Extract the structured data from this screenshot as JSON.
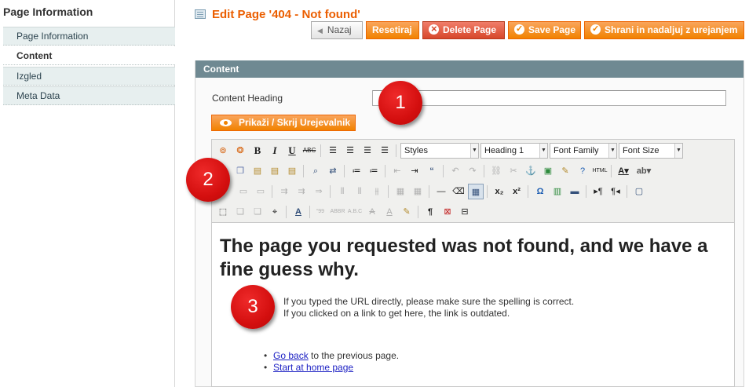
{
  "sidebar": {
    "title": "Page Information",
    "items": [
      {
        "label": "Page Information"
      },
      {
        "label": "Content"
      },
      {
        "label": "Izgled"
      },
      {
        "label": "Meta Data"
      }
    ]
  },
  "header": {
    "title": "Edit Page '404 - Not found'",
    "buttons": {
      "back": "Nazaj",
      "reset": "Resetiraj",
      "delete": "Delete Page",
      "save": "Save Page",
      "save_continue": "Shrani in nadaljuj z urejanjem"
    }
  },
  "content": {
    "section_title": "Content",
    "heading_label": "Content Heading",
    "heading_value": "",
    "toggle_editor": "Prikaži / Skrij Urejevalnik"
  },
  "toolbar": {
    "styles": "Styles",
    "format": "Heading 1",
    "font_family": "Font Family",
    "font_size": "Font Size"
  },
  "editor": {
    "heading": "The page you requested was not found, and we have a fine guess why.",
    "line1": "If you typed the URL directly, please make sure the spelling is correct.",
    "line2": "If you clicked on a link to get here, the link is outdated.",
    "links": [
      {
        "link": "Go back",
        "rest": " to the previous page."
      },
      {
        "link": "Start at home page",
        "rest": ""
      }
    ]
  },
  "markers": [
    "1",
    "2",
    "3"
  ],
  "colors": {
    "accent": "#f18200",
    "title": "#eb5e00",
    "section_header": "#6f8992",
    "marker": "#d40f0f"
  }
}
